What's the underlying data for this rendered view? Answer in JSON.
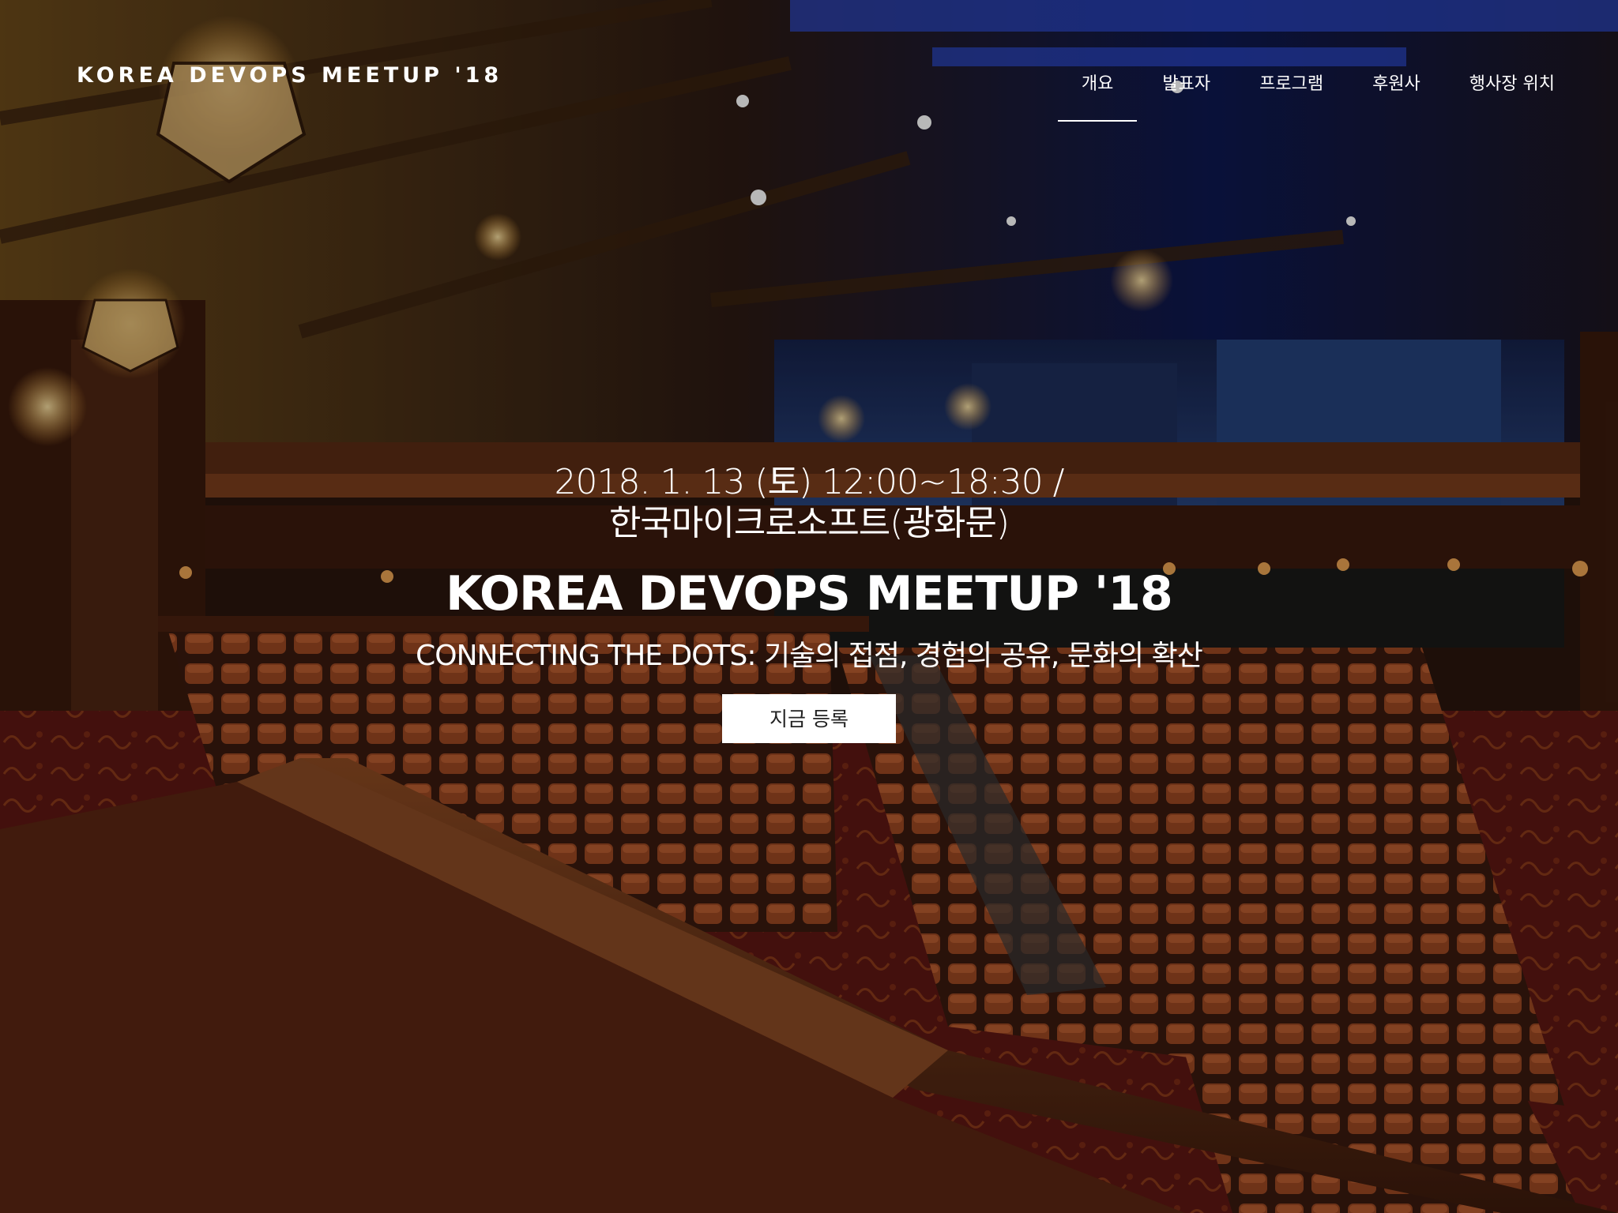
{
  "header": {
    "logo": "KOREA DEVOPS MEETUP '18",
    "nav": [
      {
        "label": "개요",
        "active": true
      },
      {
        "label": "발표자",
        "active": false
      },
      {
        "label": "프로그램",
        "active": false
      },
      {
        "label": "후원사",
        "active": false
      },
      {
        "label": "행사장 위치",
        "active": false
      }
    ]
  },
  "hero": {
    "date_line": "2018. 1. 13 (토) 12:00~18:30 /",
    "venue_line": "한국마이크로소프트(광화문)",
    "title": "KOREA DEVOPS MEETUP '18",
    "tagline": "CONNECTING THE DOTS: 기술의 접점, 경험의 공유, 문화의 확산",
    "register_label": "지금 등록"
  },
  "colors": {
    "text": "#ffffff",
    "button_bg": "#ffffff",
    "button_text": "#222222",
    "carpet": "#6a1612",
    "seat": "#8a3c1d",
    "wood": "#5a2a12",
    "stage_blue": "#1f3a78"
  }
}
